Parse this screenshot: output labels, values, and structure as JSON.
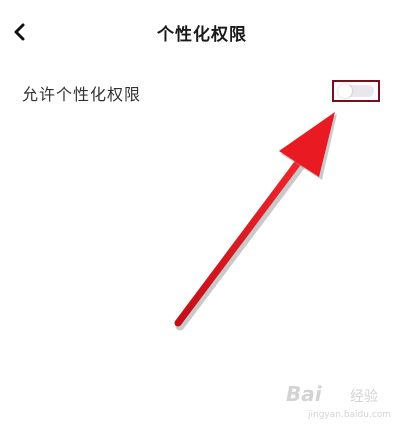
{
  "header": {
    "back_icon": "chevron-left-icon",
    "title": "个性化权限"
  },
  "settings": {
    "allow_personalization": {
      "label": "允许个性化权限",
      "enabled": false
    }
  },
  "annotation": {
    "arrow_color": "#e8141e",
    "highlight_color": "#7a0e1e"
  },
  "watermark": {
    "logo": "Bai",
    "text": "经验",
    "url": "jingyan.baidu.com"
  }
}
